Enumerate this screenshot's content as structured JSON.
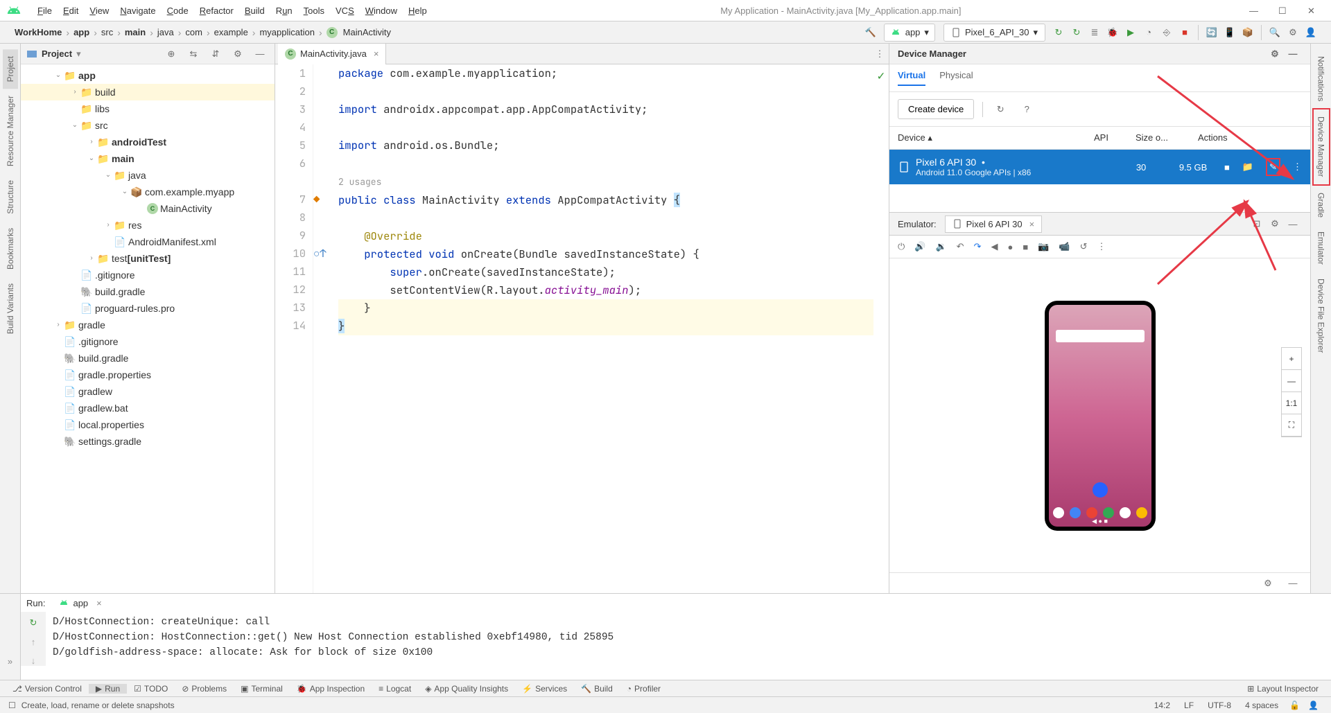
{
  "menu": {
    "file": "File",
    "edit": "Edit",
    "view": "View",
    "navigate": "Navigate",
    "code": "Code",
    "refactor": "Refactor",
    "build": "Build",
    "run": "Run",
    "tools": "Tools",
    "vcs": "VCS",
    "window": "Window",
    "help": "Help"
  },
  "title": "My Application - MainActivity.java [My_Application.app.main]",
  "breadcrumbs": [
    "WorkHome",
    "app",
    "src",
    "main",
    "java",
    "com",
    "example",
    "myapplication",
    "MainActivity"
  ],
  "run_config": "app",
  "device_select": "Pixel_6_API_30",
  "left_rail": [
    "Project",
    "Resource Manager",
    "Structure",
    "Bookmarks",
    "Build Variants"
  ],
  "right_rail": [
    "Notifications",
    "Device Manager",
    "Gradle",
    "Emulator",
    "Device File Explorer"
  ],
  "project_pane": {
    "title": "Project"
  },
  "tree": {
    "app": "app",
    "build": "build",
    "libs": "libs",
    "src": "src",
    "androidTest": "androidTest",
    "main": "main",
    "java": "java",
    "pkg": "com.example.myapp",
    "activity": "MainActivity",
    "res": "res",
    "manifest": "AndroidManifest.xml",
    "test": "test",
    "unit": "[unitTest]",
    "gitignore": ".gitignore",
    "buildgradle": "build.gradle",
    "proguard": "proguard-rules.pro",
    "gradle": "gradle",
    "gradleprops": "gradle.properties",
    "gradlew": "gradlew",
    "gradlewbat": "gradlew.bat",
    "localprops": "local.properties",
    "settings": "settings.gradle"
  },
  "editor": {
    "tab": "MainActivity.java",
    "usages": "2 usages",
    "lines": {
      "1": "package com.example.myapplication;",
      "3": "import androidx.appcompat.app.AppCompatActivity;",
      "5": "import android.os.Bundle;",
      "7": "public class MainActivity extends AppCompatActivity {",
      "9": "@Override",
      "10": "protected void onCreate(Bundle savedInstanceState) {",
      "11": "super.onCreate(savedInstanceState);",
      "12": "setContentView(R.layout.activity_main);",
      "13": "}",
      "14": "}"
    }
  },
  "device_manager": {
    "title": "Device Manager",
    "tabs": {
      "virtual": "Virtual",
      "physical": "Physical"
    },
    "create": "Create device",
    "cols": {
      "device": "Device",
      "api": "API",
      "size": "Size o...",
      "actions": "Actions"
    },
    "row": {
      "name": "Pixel 6 API 30",
      "sub": "Android 11.0 Google APIs | x86",
      "api": "30",
      "size": "9.5 GB"
    }
  },
  "emulator": {
    "label": "Emulator:",
    "tab": "Pixel 6 API 30"
  },
  "run_panel": {
    "label": "Run:",
    "tab": "app",
    "log1": "D/HostConnection: createUnique: call",
    "log2": "D/HostConnection: HostConnection::get() New Host Connection established 0xebf14980, tid 25895",
    "log3": "D/goldfish-address-space: allocate: Ask for block of size 0x100"
  },
  "bottom_bar": {
    "vc": "Version Control",
    "run": "Run",
    "todo": "TODO",
    "problems": "Problems",
    "terminal": "Terminal",
    "appinsp": "App Inspection",
    "logcat": "Logcat",
    "quality": "App Quality Insights",
    "services": "Services",
    "build": "Build",
    "profiler": "Profiler",
    "layout": "Layout Inspector"
  },
  "status": {
    "msg": "Create, load, rename or delete snapshots",
    "pos": "14:2",
    "lf": "LF",
    "enc": "UTF-8",
    "spaces": "4 spaces"
  }
}
